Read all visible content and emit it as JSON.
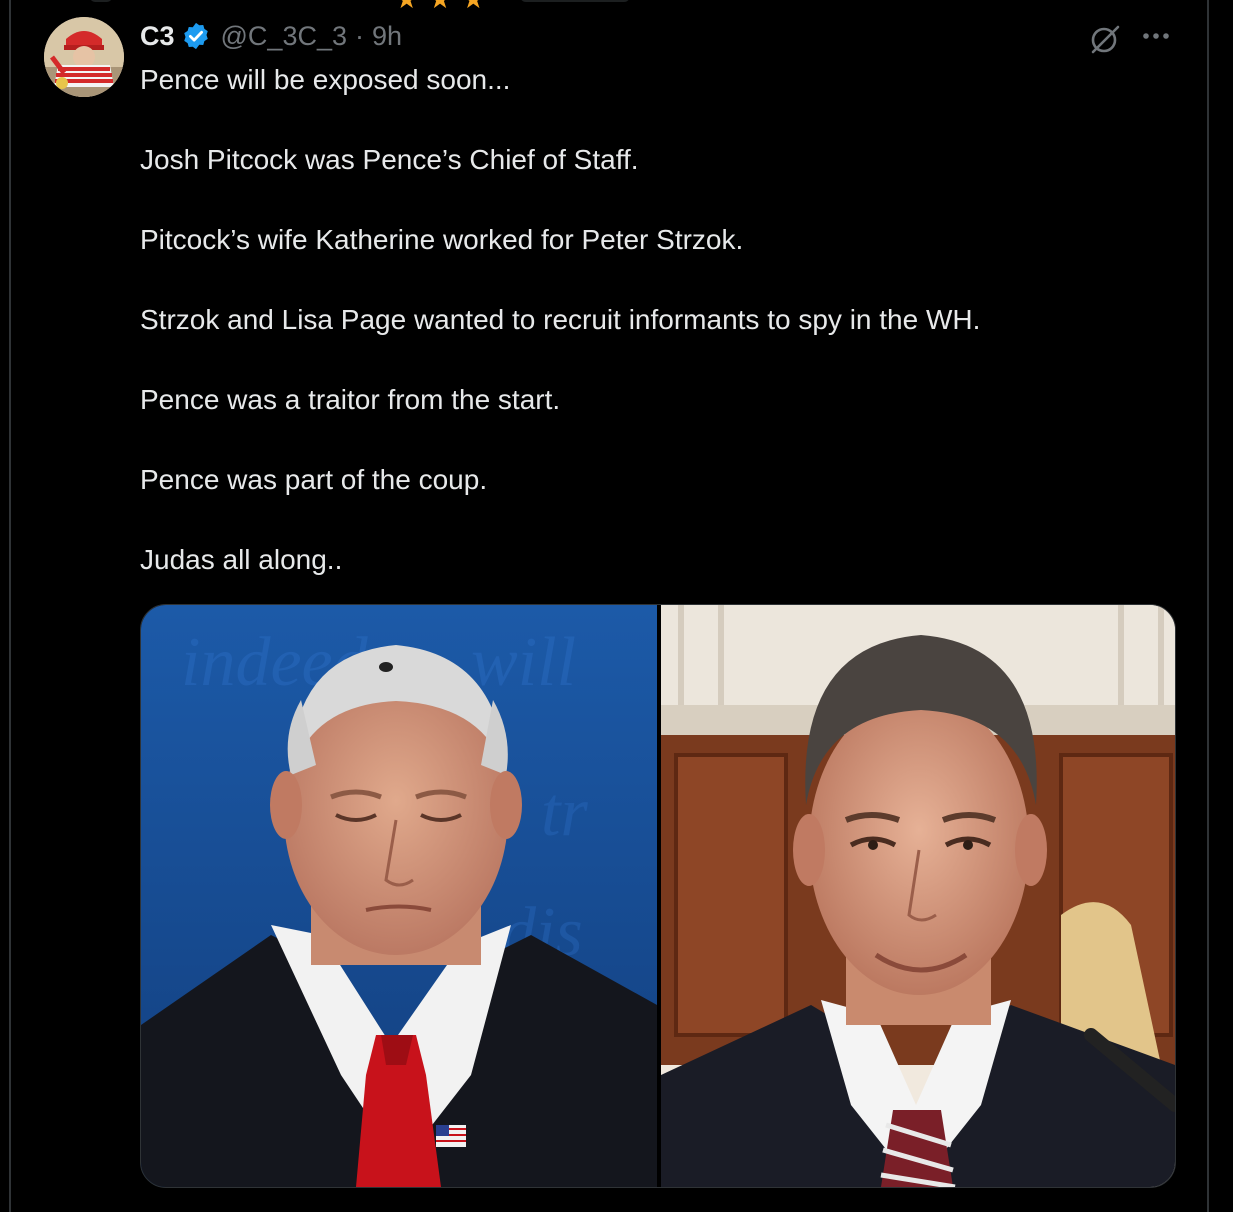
{
  "tweet": {
    "author_name": "C3",
    "handle": "@C_3C_3",
    "separator": "·",
    "time": "9h",
    "paragraphs": [
      "Pence will be exposed soon...",
      "Josh Pitcock was Pence’s Chief of Staff.",
      "Pitcock’s wife Katherine worked for Peter Strzok.",
      "Strzok and Lisa Page wanted to recruit informants to spy in the WH.",
      "Pence was a traitor from the start.",
      "Pence was part of the coup.",
      "Judas all along.."
    ]
  },
  "icons": {
    "verified": "verified-badge-icon",
    "grok": "grok-icon",
    "more": "more-options-icon"
  },
  "colors": {
    "background": "#000000",
    "text": "#e7e9ea",
    "muted": "#71767b",
    "verified": "#1d9bf0",
    "border": "#2f3336"
  }
}
